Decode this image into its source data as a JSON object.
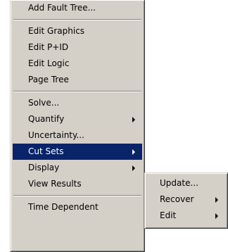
{
  "main_menu": {
    "groups": [
      [
        {
          "label": "Add Fault Tree...",
          "submenu": false
        }
      ],
      [
        {
          "label": "Edit Graphics",
          "submenu": false
        },
        {
          "label": "Edit P+ID",
          "submenu": false
        },
        {
          "label": "Edit Logic",
          "submenu": false
        },
        {
          "label": "Page Tree",
          "submenu": false
        }
      ],
      [
        {
          "label": "Solve...",
          "submenu": false
        },
        {
          "label": "Quantify",
          "submenu": true
        },
        {
          "label": "Uncertainty...",
          "submenu": false
        },
        {
          "label": "Cut Sets",
          "submenu": true,
          "highlighted": true
        },
        {
          "label": "Display",
          "submenu": true
        },
        {
          "label": "View Results",
          "submenu": false
        }
      ],
      [
        {
          "label": "Time Dependent",
          "submenu": false
        }
      ]
    ]
  },
  "sub_menu": {
    "items": [
      {
        "label": "Update...",
        "submenu": false
      },
      {
        "label": "Recover",
        "submenu": true
      },
      {
        "label": "Edit",
        "submenu": true
      }
    ]
  },
  "colors": {
    "menu_face": "#d4d0c8",
    "highlight_bg": "#0a246a",
    "highlight_text": "#ffffff"
  }
}
